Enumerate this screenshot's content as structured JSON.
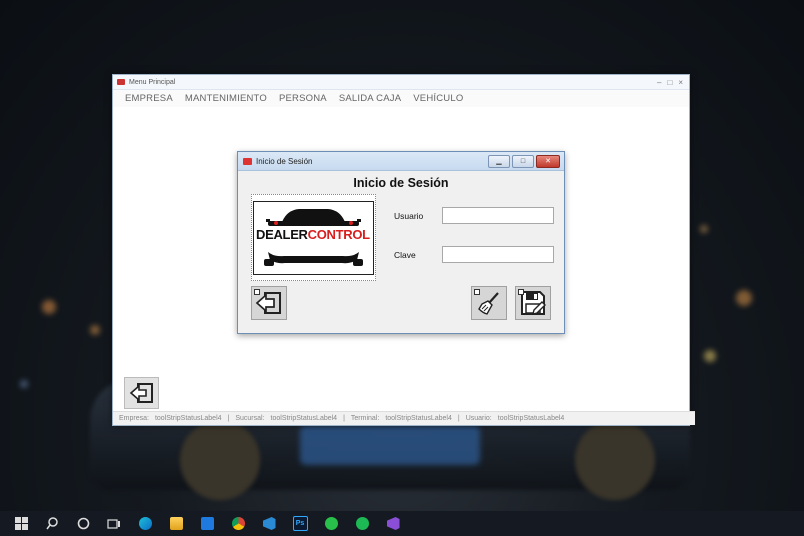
{
  "main_window": {
    "title": "Menu Principal",
    "menu": [
      "EMPRESA",
      "MANTENIMIENTO",
      "PERSONA",
      "SALIDA CAJA",
      "VEHÍCULO"
    ],
    "status": {
      "empresa_label": "Empresa:",
      "empresa_value": "toolStripStatusLabel4",
      "sucursal_label": "Sucursal:",
      "sucursal_value": "toolStripStatusLabel4",
      "terminal_label": "Terminal:",
      "terminal_value": "toolStripStatusLabel4",
      "usuario_label": "Usuario:",
      "usuario_value": "toolStripStatusLabel4",
      "separator": "|"
    }
  },
  "login_dialog": {
    "title": "Inicio de Sesión",
    "heading": "Inicio de Sesión",
    "usuario_label": "Usuario",
    "clave_label": "Clave",
    "usuario_value": "",
    "clave_value": "",
    "logo_text_part1": "DEALER",
    "logo_text_part2": "CONTROL",
    "buttons": {
      "exit_icon": "exit-arrow-icon",
      "clear_icon": "broom-icon",
      "save_icon": "floppy-disk-icon"
    }
  },
  "taskbar": {
    "items": [
      "windows-start-icon",
      "search-icon",
      "cortana-icon",
      "task-view-icon",
      "edge-icon",
      "file-explorer-icon",
      "mail-icon",
      "chrome-icon",
      "vscode-icon",
      "photoshop-icon",
      "whatsapp-icon",
      "spotify-icon",
      "visual-studio-icon"
    ],
    "photoshop_label": "Ps"
  },
  "colors": {
    "logo_red": "#d81e1e",
    "logo_black": "#111111",
    "title_gradient": "#c7daf0",
    "close_red": "#c0392b"
  }
}
